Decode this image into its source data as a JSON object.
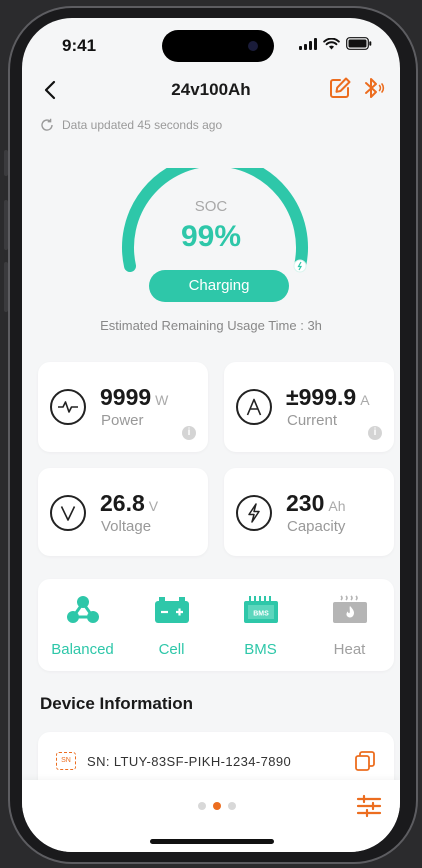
{
  "status": {
    "time": "9:41"
  },
  "header": {
    "title": "24v100Ah"
  },
  "updated": {
    "text": "Data updated 45 seconds ago"
  },
  "soc": {
    "label": "SOC",
    "value": "99%",
    "percent": 99,
    "status": "Charging"
  },
  "estimate": {
    "text": "Estimated Remaining Usage Time : 3h"
  },
  "metrics": {
    "power": {
      "value": "9999",
      "unit": "W",
      "label": "Power"
    },
    "current": {
      "value": "±999.9",
      "unit": "A",
      "label": "Current"
    },
    "voltage": {
      "value": "26.8",
      "unit": "V",
      "label": "Voltage"
    },
    "capacity": {
      "value": "230",
      "unit": "Ah",
      "label": "Capacity"
    }
  },
  "functions": [
    {
      "label": "Balanced",
      "icon": "balanced-icon",
      "active": true
    },
    {
      "label": "Cell",
      "icon": "cell-icon",
      "active": true
    },
    {
      "label": "BMS",
      "icon": "bms-icon",
      "active": true
    },
    {
      "label": "Heat",
      "icon": "heat-icon",
      "active": false
    }
  ],
  "device": {
    "section_title": "Device Information",
    "sn_badge": "SN",
    "sn": "SN: LTUY-83SF-PIKH-1234-7890"
  },
  "colors": {
    "accent": "#2ec7a9",
    "brand": "#ec6d1f",
    "inactive": "#a0a0a0"
  }
}
